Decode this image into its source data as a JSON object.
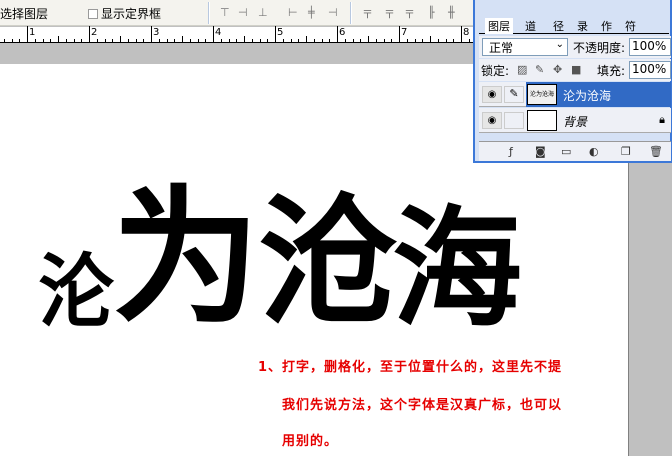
{
  "options_bar": {
    "auto_select_label": "选择图层",
    "show_bounds_label": "显示定界框",
    "show_bounds_checked": false,
    "align_icons": [
      "align-top-icon",
      "align-vcenter-icon",
      "align-bottom-icon",
      "align-left-icon",
      "align-hcenter-icon",
      "align-right-icon",
      "distribute-top-icon",
      "distribute-vcenter-icon",
      "distribute-bottom-icon",
      "distribute-left-icon",
      "distribute-hcenter-icon"
    ]
  },
  "ruler": {
    "labels": [
      "1",
      "2",
      "3",
      "4",
      "5",
      "6",
      "7",
      "8"
    ]
  },
  "canvas": {
    "big_chars": [
      "沦",
      "为",
      "沧",
      "海"
    ],
    "note_lines": [
      "1、打字，删格化，至于位置什么的，这里先不提",
      "我们先说方法，这个字体是汉真广标，也可以",
      "用别的。"
    ],
    "note_color": "#e60000"
  },
  "layers_panel": {
    "tabs": [
      "图层",
      "道",
      "径",
      "录",
      "作",
      "符"
    ],
    "blend_mode": "正常",
    "opacity_label": "不透明度:",
    "opacity_value": "100%",
    "lock_label": "锁定:",
    "fill_label": "填充:",
    "fill_value": "100%",
    "layers": [
      {
        "name": "沦为沧海",
        "thumb_text": "沦为沧海",
        "selected": true,
        "visible": true
      },
      {
        "name": "背景",
        "selected": false,
        "visible": true,
        "locked": true
      }
    ],
    "selected_color": "#316ac5"
  }
}
